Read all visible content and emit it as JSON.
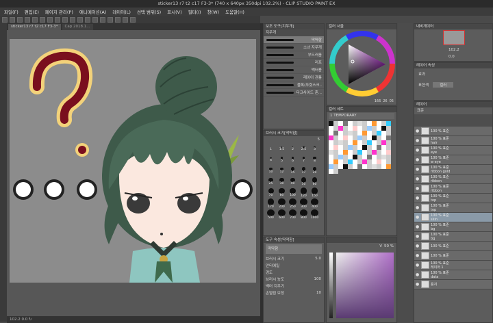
{
  "window": {
    "title": "sticker13 r7 t2 c17 F3-3* (740 x 640px 350dpi 102.2%) - CLIP STUDIO PAINT EX"
  },
  "menu": [
    "파일(F)",
    "편집(E)",
    "페이지 관리(P)",
    "애니메이션(A)",
    "레이어(L)",
    "선택 범위(S)",
    "표시(V)",
    "필터(I)",
    "창(W)",
    "도움말(H)"
  ],
  "tabs": [
    {
      "label": "sticker13 r7 t2 c17 F3-3*"
    },
    {
      "label": "Cap 2018.1..."
    }
  ],
  "status": {
    "text": "102.2  0.0  ↻"
  },
  "canvas": {
    "question_color": "#7a0f1e",
    "question_outline": "#f3d27a",
    "dots": 4
  },
  "brush_panel": {
    "title": "보조 도구[지우개]",
    "tab": "지우개",
    "items": [
      "딱딱함",
      "소녀 지우개",
      "부드러움",
      "러프",
      "벡터용",
      "레이어 관통",
      "블록(뚜렷스크..",
      "다크사이드 혼..."
    ]
  },
  "size_panel": {
    "title": "브러시 크기[딱딱함]",
    "value_label": "5",
    "sizes": [
      "1",
      "1.5",
      "2",
      "2.5",
      "3",
      "4",
      "5",
      "6",
      "7",
      "8",
      "10",
      "12",
      "15",
      "17",
      "20",
      "25",
      "30",
      "40",
      "50",
      "60",
      "70",
      "80",
      "100",
      "120",
      "150",
      "170",
      "200",
      "250",
      "300",
      "400",
      "500",
      "600",
      "700",
      "800",
      "1000"
    ]
  },
  "color_wheel": {
    "title": "컬러 서클",
    "readout": [
      "166",
      "26",
      "05"
    ]
  },
  "color_set": {
    "title": "컬러 세트",
    "set_name": "1 TEMPORARY"
  },
  "tool_props": {
    "title": "도구 속성[딱딱함]",
    "header": "딱딱함",
    "rows": [
      {
        "label": "브러시 크기",
        "value": "5.0"
      },
      {
        "label": "안티에일",
        "value": ""
      },
      {
        "label": "경도",
        "value": ""
      },
      {
        "label": "브러시 농도",
        "value": "100"
      },
      {
        "label": "벡터 지우기",
        "value": ""
      },
      {
        "label": "손떨림 보정",
        "value": "10"
      }
    ]
  },
  "color_slider": {
    "label": "V",
    "value": "50 %"
  },
  "navigator": {
    "title": "내비게이터",
    "zoom": "102.2",
    "angle": "0.0"
  },
  "layer_prop": {
    "title": "레이어 속성",
    "effect_label": "효과",
    "expression_label": "표현색",
    "expression_value": "컬러"
  },
  "layers": {
    "title": "레이어",
    "blend": "표준",
    "items": [
      {
        "pct": "100 %",
        "mode": "표준",
        "name": "",
        "sel": false
      },
      {
        "pct": "100 %",
        "mode": "표준",
        "name": "hair",
        "sel": false
      },
      {
        "pct": "100 %",
        "mode": "표준",
        "name": "eye",
        "sel": false
      },
      {
        "pct": "100 %",
        "mode": "표준",
        "name": "w eye",
        "sel": false
      },
      {
        "pct": "100 %",
        "mode": "표준",
        "name": "ribbon gold",
        "sel": false
      },
      {
        "pct": "100 %",
        "mode": "표준",
        "name": "ribbon",
        "sel": false
      },
      {
        "pct": "100 %",
        "mode": "표준",
        "name": "ribbon",
        "sel": false
      },
      {
        "pct": "100 %",
        "mode": "표준",
        "name": "top",
        "sel": false
      },
      {
        "pct": "100 %",
        "mode": "표준",
        "name": "top",
        "sel": false
      },
      {
        "pct": "100 %",
        "mode": "표준",
        "name": "skin",
        "sel": true
      },
      {
        "pct": "100 %",
        "mode": "표준",
        "name": "bg",
        "sel": false
      },
      {
        "pct": "100 %",
        "mode": "표준",
        "name": "bg",
        "sel": false
      },
      {
        "pct": "100 %",
        "mode": "표준",
        "name": "",
        "sel": false
      },
      {
        "pct": "100 %",
        "mode": "표준",
        "name": "",
        "sel": false
      },
      {
        "pct": "100 %",
        "mode": "표준",
        "name": "레이어 1",
        "sel": false
      },
      {
        "pct": "100 %",
        "mode": "표준",
        "name": "data",
        "sel": false
      },
      {
        "pct": "",
        "mode": "",
        "name": "용지",
        "sel": false
      }
    ]
  }
}
